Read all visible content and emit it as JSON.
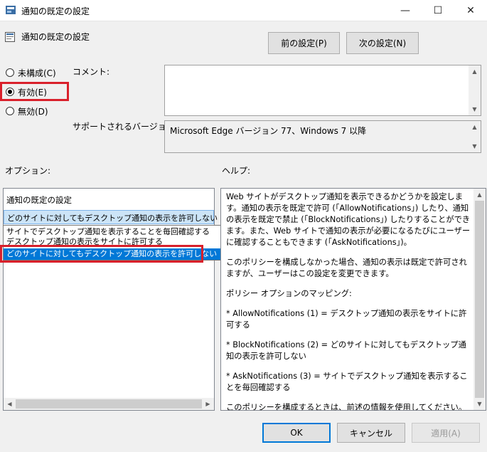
{
  "window": {
    "title": "通知の既定の設定",
    "minimize": "—",
    "maximize": "☐",
    "close": "✕"
  },
  "header": {
    "policy_name": "通知の既定の設定",
    "prev_button": "前の設定(P)",
    "next_button": "次の設定(N)"
  },
  "state": {
    "not_configured": "未構成(C)",
    "enabled": "有効(E)",
    "disabled": "無効(D)",
    "selected": "enabled"
  },
  "comment": {
    "label": "コメント:",
    "value": ""
  },
  "supported": {
    "label": "サポートされるバージョン:",
    "value": "Microsoft Edge バージョン 77、Windows 7 以降"
  },
  "options": {
    "label": "オプション:",
    "setting_label": "通知の既定の設定",
    "selected_value": "どのサイトに対してもデスクトップ通知の表示を許可しない",
    "dropdown_items": [
      "サイトでデスクトップ通知を表示することを毎回確認する",
      "デスクトップ通知の表示をサイトに許可する",
      "どのサイトに対してもデスクトップ通知の表示を許可しない"
    ],
    "highlighted_index": 2
  },
  "help": {
    "label": "ヘルプ:",
    "paragraphs": [
      "Web サイトがデスクトップ通知を表示できるかどうかを設定します。通知の表示を既定で許可 (「AllowNotifications」) したり、通知の表示を既定で禁止 (「BlockNotifications」) したりすることができます。また、Web サイトで通知の表示が必要になるたびにユーザーに確認することもできます (「AskNotifications」)。",
      "このポリシーを構成しなかった場合、通知の表示は既定で許可されますが、ユーザーはこの設定を変更できます。",
      "ポリシー オプションのマッピング:",
      "* AllowNotifications (1) = デスクトップ通知の表示をサイトに許可する",
      "* BlockNotifications (2) = どのサイトに対してもデスクトップ通知の表示を許可しない",
      "* AskNotifications (3) = サイトでデスクトップ通知を表示することを毎回確認する",
      "このポリシーを構成するときは、前述の情報を使用してください。"
    ]
  },
  "footer": {
    "ok": "OK",
    "cancel": "キャンセル",
    "apply": "適用(A)"
  },
  "colors": {
    "accent": "#0078d7",
    "highlight_red": "#d9202b",
    "selection_bg": "#cce4f7"
  }
}
